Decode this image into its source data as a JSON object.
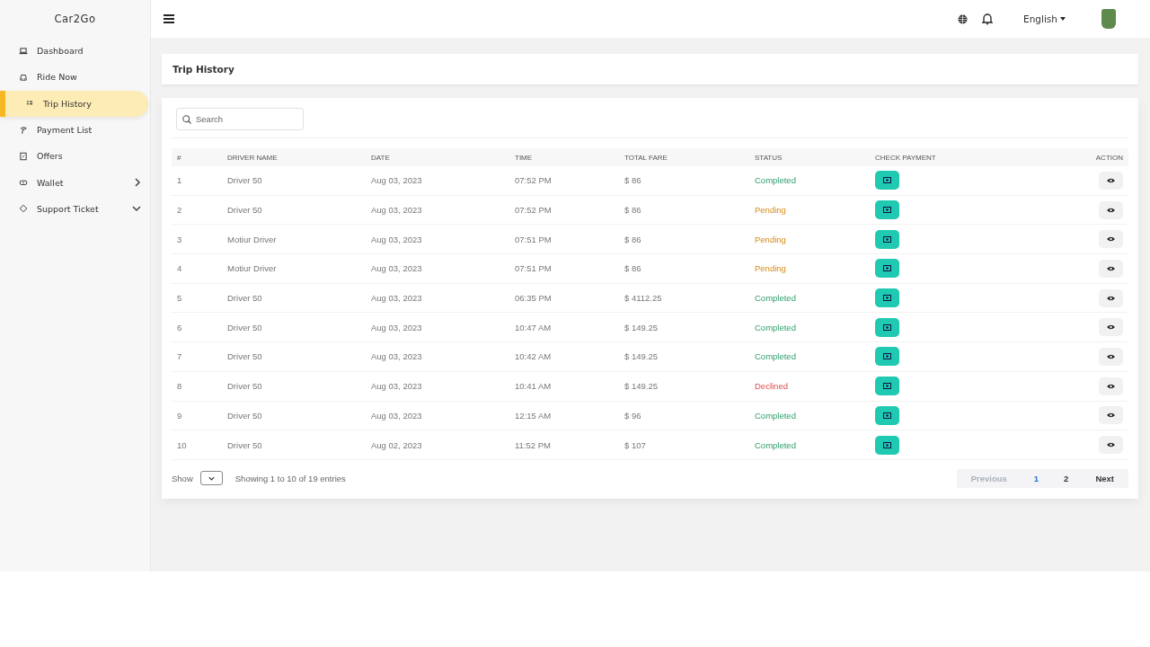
{
  "brand": "Car2Go",
  "sidebar": {
    "items": [
      {
        "label": "Dashboard",
        "kind": "link",
        "selected": false
      },
      {
        "label": "Ride Now",
        "kind": "link",
        "selected": false
      },
      {
        "label": "Trip History",
        "kind": "link",
        "selected": true
      },
      {
        "label": "Payment List",
        "kind": "link",
        "selected": false
      },
      {
        "label": "Offers",
        "kind": "link",
        "selected": false
      },
      {
        "label": "Wallet",
        "kind": "group",
        "selected": false,
        "expanded": false
      },
      {
        "label": "Support Ticket",
        "kind": "group",
        "selected": false,
        "expanded": true
      }
    ]
  },
  "topbar": {
    "language": "English"
  },
  "page_title": "Trip History",
  "search": {
    "placeholder": "Search"
  },
  "table": {
    "columns": [
      "#",
      "DRIVER NAME",
      "DATE",
      "TIME",
      "TOTAL FARE",
      "STATUS",
      "CHECK PAYMENT",
      "ACTION"
    ],
    "rows": [
      {
        "no": "1",
        "driver": "Driver 50",
        "date": "Aug 03, 2023",
        "time": "07:52 PM",
        "fare": "$ 86",
        "status": "Completed",
        "kind": "completed"
      },
      {
        "no": "2",
        "driver": "Driver 50",
        "date": "Aug 03, 2023",
        "time": "07:52 PM",
        "fare": "$ 86",
        "status": "Pending",
        "kind": "pending"
      },
      {
        "no": "3",
        "driver": "Motiur Driver",
        "date": "Aug 03, 2023",
        "time": "07:51 PM",
        "fare": "$ 86",
        "status": "Pending",
        "kind": "pending"
      },
      {
        "no": "4",
        "driver": "Motiur Driver",
        "date": "Aug 03, 2023",
        "time": "07:51 PM",
        "fare": "$ 86",
        "status": "Pending",
        "kind": "pending"
      },
      {
        "no": "5",
        "driver": "Driver 50",
        "date": "Aug 03, 2023",
        "time": "06:35 PM",
        "fare": "$ 4112.25",
        "status": "Completed",
        "kind": "completed"
      },
      {
        "no": "6",
        "driver": "Driver 50",
        "date": "Aug 03, 2023",
        "time": "10:47 AM",
        "fare": "$ 149.25",
        "status": "Completed",
        "kind": "completed"
      },
      {
        "no": "7",
        "driver": "Driver 50",
        "date": "Aug 03, 2023",
        "time": "10:42 AM",
        "fare": "$ 149.25",
        "status": "Completed",
        "kind": "completed"
      },
      {
        "no": "8",
        "driver": "Driver 50",
        "date": "Aug 03, 2023",
        "time": "10:41 AM",
        "fare": "$ 149.25",
        "status": "Declined",
        "kind": "declined"
      },
      {
        "no": "9",
        "driver": "Driver 50",
        "date": "Aug 03, 2023",
        "time": "12:15 AM",
        "fare": "$ 96",
        "status": "Completed",
        "kind": "completed"
      },
      {
        "no": "10",
        "driver": "Driver 50",
        "date": "Aug 02, 2023",
        "time": "11:52 PM",
        "fare": "$ 107",
        "status": "Completed",
        "kind": "completed"
      }
    ]
  },
  "footer": {
    "show_label": "Show",
    "info": "Showing 1 to 10 of 19 entries",
    "pagination": [
      {
        "label": "Previous",
        "kind": "prev",
        "disabled": true
      },
      {
        "label": "1",
        "kind": "page",
        "selected": true
      },
      {
        "label": "2",
        "kind": "page",
        "selected": false
      },
      {
        "label": "Next",
        "kind": "next",
        "disabled": false
      }
    ]
  }
}
